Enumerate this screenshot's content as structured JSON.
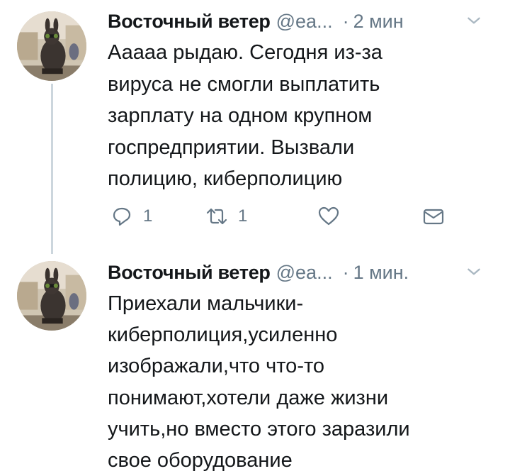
{
  "tweets": [
    {
      "name": "Восточный ветер",
      "handle": "@ea...",
      "separator": "·",
      "time": "2 мин",
      "text": "Ааааа рыдаю. Сегодня из-за\nвируса не смогли выплатить\nзарплату на одном крупном\nгоспредприятии. Вызвали\nполицию, киберполицию",
      "actions": {
        "reply_count": "1",
        "retweet_count": "1"
      }
    },
    {
      "name": "Восточный ветер",
      "handle": "@ea...",
      "separator": "·",
      "time": "1 мин.",
      "text": "Приехали мальчики-\nкиберполиция,усиленно\nизображали,что что-то\nпонимают,хотели даже  жизни\nучить,но вместо этого заразили\nсвое  оборудование"
    }
  ],
  "icons": {
    "reply": "reply-icon",
    "retweet": "retweet-icon",
    "like": "heart-icon",
    "dm": "envelope-icon",
    "more": "chevron-down-icon"
  },
  "colors": {
    "text": "#14171a",
    "secondary": "#657786",
    "thread_line": "#ccd6dd"
  }
}
